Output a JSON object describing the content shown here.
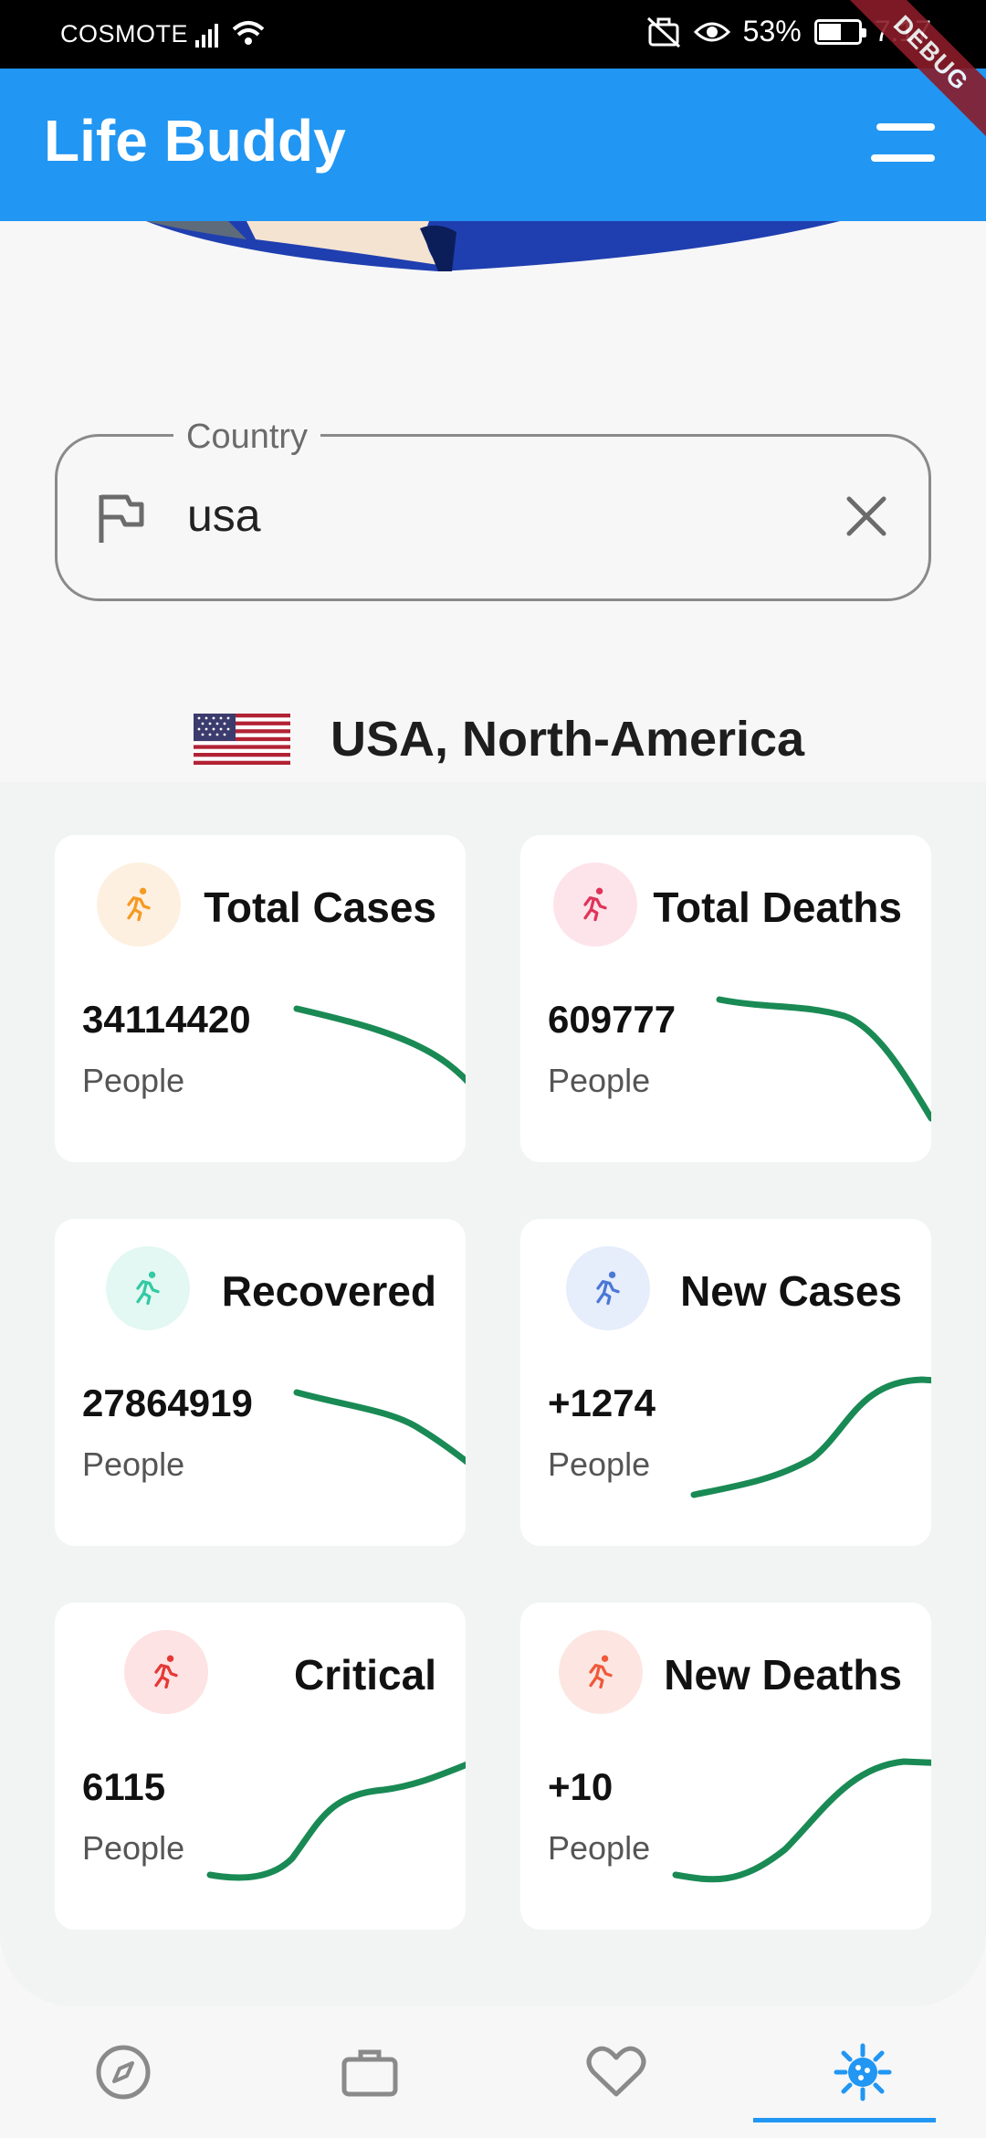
{
  "status_bar": {
    "carrier": "COSMOTE",
    "battery": "53%",
    "time": "7:17"
  },
  "debug_banner": "DEBUG",
  "app_bar": {
    "title": "Life Buddy",
    "menu_icon": "menu-icon"
  },
  "search": {
    "label": "Country",
    "value": "usa",
    "icon": "flag-icon",
    "clear_icon": "close-icon"
  },
  "country": {
    "name": "USA, North-America",
    "flag_icon": "us-flag-icon"
  },
  "stats": [
    {
      "title": "Total Cases",
      "value": "34114420",
      "unit": "People",
      "icon_color": "#f59a23",
      "icon_bg": "#fef0e0",
      "trend": "down"
    },
    {
      "title": "Total Deaths",
      "value": "609777",
      "unit": "People",
      "icon_color": "#e0345b",
      "icon_bg": "#fde4ea",
      "trend": "down"
    },
    {
      "title": "Recovered",
      "value": "27864919",
      "unit": "People",
      "icon_color": "#33c9a4",
      "icon_bg": "#e3f8f2",
      "trend": "down"
    },
    {
      "title": "New Cases",
      "value": "+1274",
      "unit": "People",
      "icon_color": "#4a78d6",
      "icon_bg": "#e6edfb",
      "trend": "up"
    },
    {
      "title": "Critical",
      "value": "6115",
      "unit": "People",
      "icon_color": "#e53935",
      "icon_bg": "#fde3e3",
      "trend": "up"
    },
    {
      "title": "New Deaths",
      "value": "+10",
      "unit": "People",
      "icon_color": "#ef5a3a",
      "icon_bg": "#fde6e1",
      "trend": "up"
    }
  ],
  "colors": {
    "accent": "#2196f3",
    "sparkline": "#1a8a55",
    "nav_inactive": "#8a8a8a"
  },
  "bottom_nav": [
    {
      "icon": "compass-icon",
      "active": false
    },
    {
      "icon": "briefcase-icon",
      "active": false
    },
    {
      "icon": "heart-icon",
      "active": false
    },
    {
      "icon": "virus-icon",
      "active": true
    }
  ]
}
